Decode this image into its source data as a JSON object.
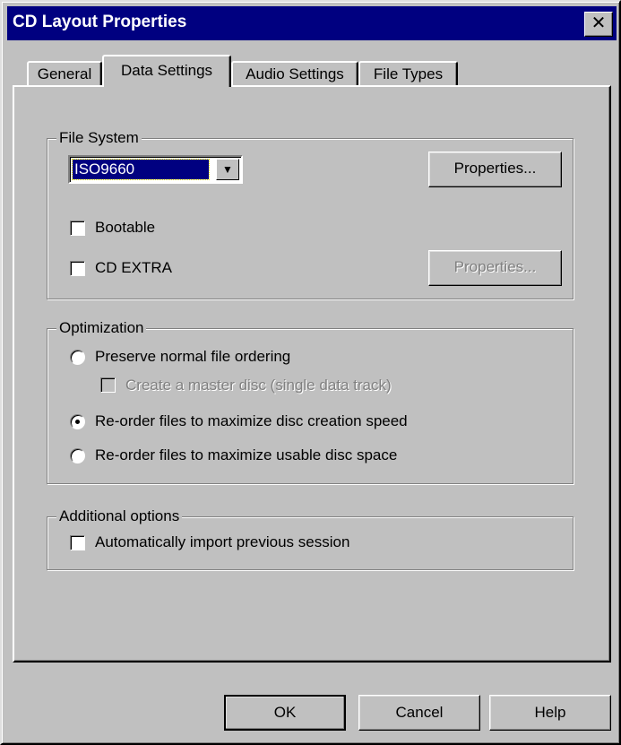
{
  "window": {
    "title": "CD Layout Properties",
    "close_glyph": "✕"
  },
  "tabs": [
    {
      "label": "General",
      "active": false
    },
    {
      "label": "Data Settings",
      "active": true
    },
    {
      "label": "Audio Settings",
      "active": false
    },
    {
      "label": "File Types",
      "active": false
    }
  ],
  "file_system": {
    "legend": "File System",
    "selected_value": "ISO9660",
    "properties_label": "Properties...",
    "bootable_label": "Bootable",
    "bootable_checked": false,
    "cd_extra_label": "CD EXTRA",
    "cd_extra_checked": false,
    "cd_extra_properties_label": "Properties..."
  },
  "optimization": {
    "legend": "Optimization",
    "preserve_label": "Preserve normal  file ordering",
    "master_disc_label": "Create a master disc (single data track)",
    "speed_label": "Re-order files to maximize disc creation speed",
    "space_label": "Re-order files to maximize usable disc space",
    "selected": "speed"
  },
  "additional": {
    "legend": "Additional options",
    "import_label": "Automatically import previous session",
    "import_checked": false
  },
  "buttons": {
    "ok": "OK",
    "cancel": "Cancel",
    "help": "Help"
  }
}
